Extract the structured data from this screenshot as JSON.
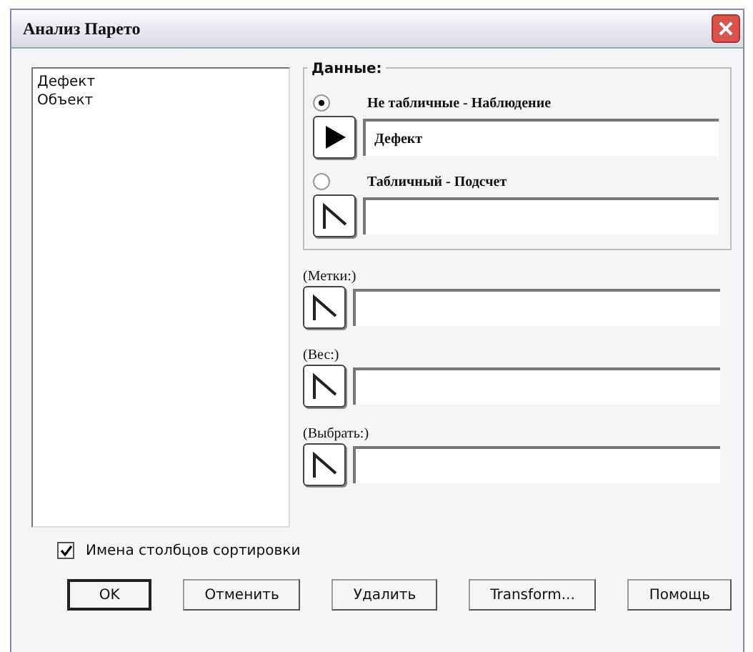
{
  "window": {
    "title": "Анализ Парето"
  },
  "variables": [
    "Дефект",
    "Объект"
  ],
  "data_group": {
    "label": "Данные:",
    "options": [
      {
        "label": "Не табличные - Наблюдение",
        "selected": true,
        "field": {
          "value": "Дефект",
          "active": true
        }
      },
      {
        "label": "Табличный - Подсчет",
        "selected": false,
        "field": {
          "active": false
        }
      }
    ]
  },
  "fields": [
    {
      "label": "(Метки:)",
      "active": false
    },
    {
      "label": "(Вес:)",
      "active": false
    },
    {
      "label": "(Выбрать:)",
      "active": false
    }
  ],
  "sort_names": {
    "label": "Имена столбцов сортировки",
    "checked": true
  },
  "buttons": [
    {
      "label": "OK",
      "default": true
    },
    {
      "label": "Отменить",
      "default": false
    },
    {
      "label": "Удалить",
      "default": false
    },
    {
      "label": "Transform...",
      "default": false
    },
    {
      "label": "Помощь",
      "default": false
    }
  ]
}
